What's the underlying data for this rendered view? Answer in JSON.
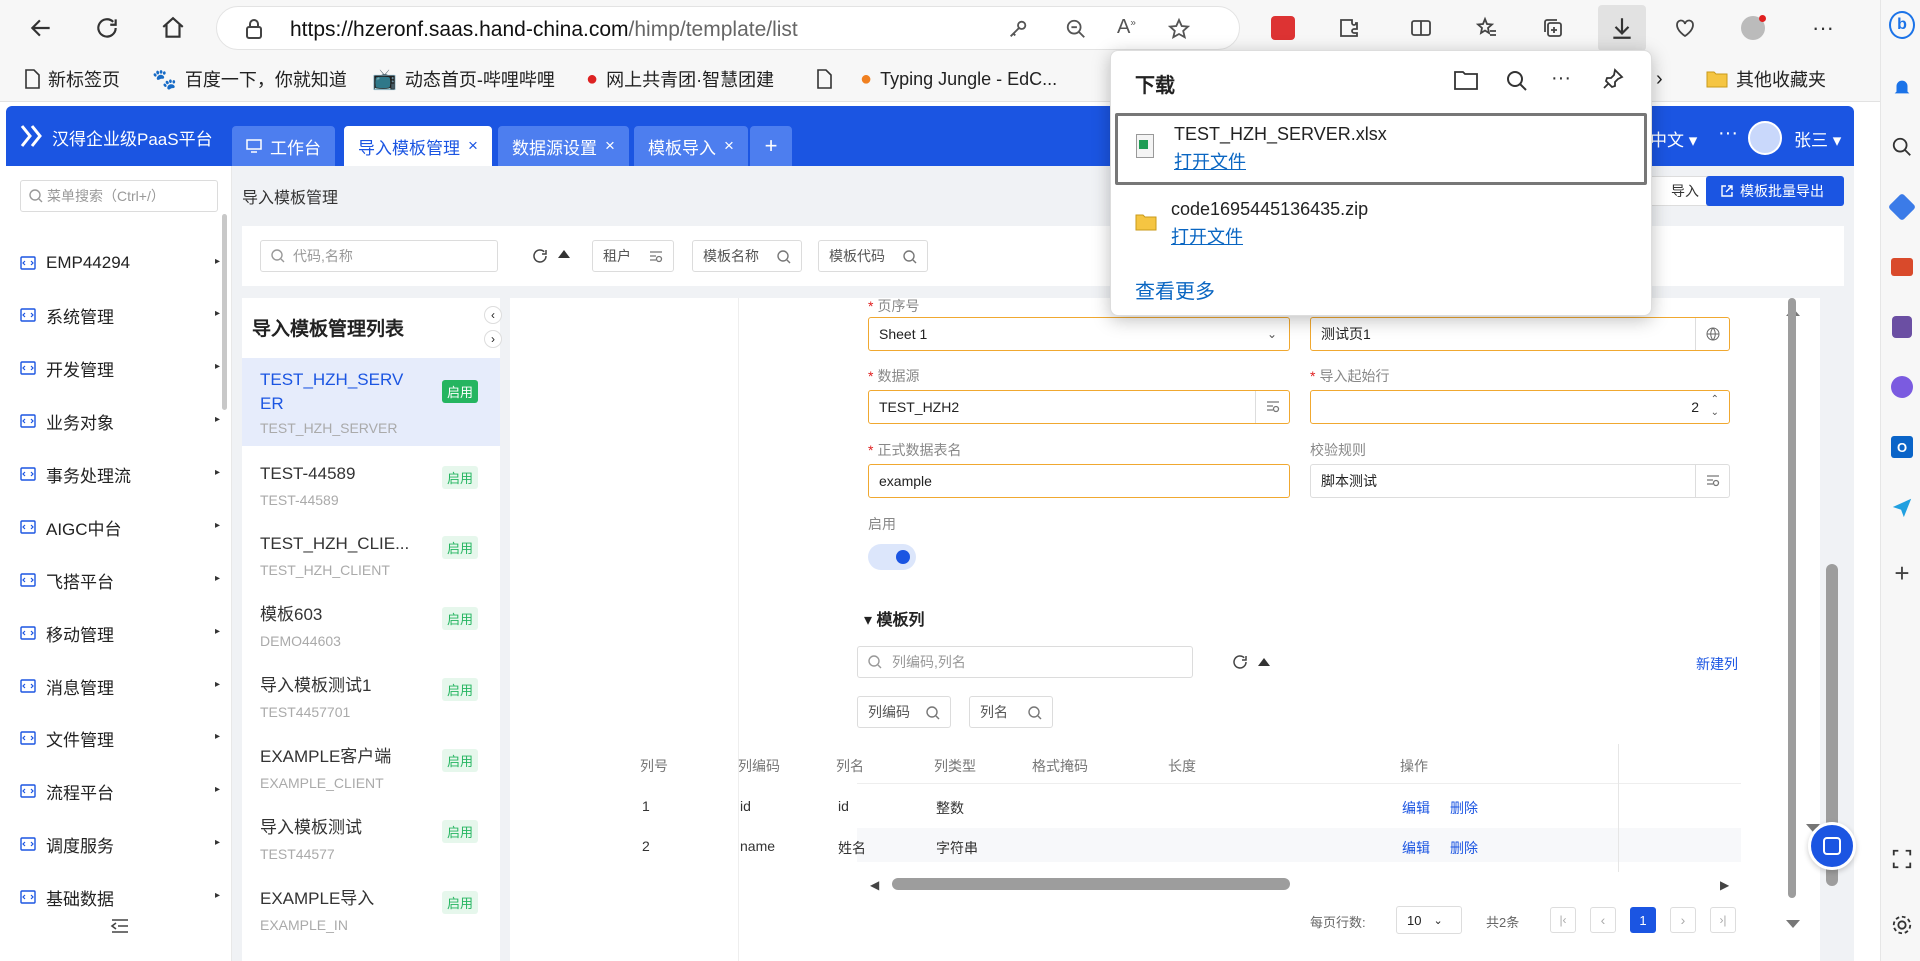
{
  "browser": {
    "url_host": "https://hzeronf.saas.hand-china.com",
    "url_path": "/himp/template/list",
    "bookmarks": [
      "新标签页",
      "百度一下，你就知道",
      "动态首页-哔哩哔哩",
      "网上共青团·智慧团建",
      "",
      "Typing Jungle - EdC..."
    ],
    "other_bookmarks": "其他收藏夹"
  },
  "downloads": {
    "title": "下载",
    "items": [
      {
        "name": "TEST_HZH_SERVER.xlsx",
        "action": "打开文件"
      },
      {
        "name": "code1695445136435.zip",
        "action": "打开文件"
      }
    ],
    "see_more": "查看更多"
  },
  "app": {
    "brand": "汉得企业级PaaS平台",
    "tabs": [
      "工作台",
      "导入模板管理",
      "数据源设置",
      "模板导入"
    ],
    "add_tab": "+",
    "lang": "中文",
    "more": "···",
    "user": "张三"
  },
  "nav": {
    "search_placeholder": "菜单搜索（Ctrl+/）",
    "items": [
      "EMP44294",
      "系统管理",
      "开发管理",
      "业务对象",
      "事务处理流",
      "AIGC中台",
      "飞搭平台",
      "移动管理",
      "消息管理",
      "文件管理",
      "流程平台",
      "调度服务",
      "基础数据"
    ]
  },
  "page": {
    "breadcrumb": "导入模板管理",
    "import_button": "导入",
    "export_button": "模板批量导出",
    "search_placeholder": "代码,名称",
    "filters": [
      "租户",
      "模板名称",
      "模板代码"
    ]
  },
  "list": {
    "title": "导入模板管理列表",
    "items": [
      {
        "name": "TEST_HZH_SERVER",
        "code": "TEST_HZH_SERVER",
        "status": "启用"
      },
      {
        "name": "TEST-44589",
        "code": "TEST-44589",
        "status": "启用"
      },
      {
        "name": "TEST_HZH_CLIE...",
        "code": "TEST_HZH_CLIENT",
        "status": "启用"
      },
      {
        "name": "模板603",
        "code": "DEMO44603",
        "status": "启用"
      },
      {
        "name": "导入模板测试1",
        "code": "TEST4457701",
        "status": "启用"
      },
      {
        "name": "EXAMPLE客户端",
        "code": "EXAMPLE_CLIENT",
        "status": "启用"
      },
      {
        "name": "导入模板测试",
        "code": "TEST44577",
        "status": "启用"
      },
      {
        "name": "EXAMPLE导入",
        "code": "EXAMPLE_IN",
        "status": "启用"
      }
    ]
  },
  "form": {
    "sheet_label": "页序号",
    "sheet_value": "Sheet 1",
    "sheet_name_value": "测试页1",
    "datasource_label": "数据源",
    "datasource_value": "TEST_HZH2",
    "start_row_label": "导入起始行",
    "start_row_value": "2",
    "table_label": "正式数据表名",
    "table_value": "example",
    "rule_label": "校验规则",
    "rule_value": "脚本测试",
    "enabled_label": "启用"
  },
  "columns_section": {
    "title": "模板列",
    "search_placeholder": "列编码,列名",
    "new_button": "新建列",
    "filters": [
      "列编码",
      "列名"
    ],
    "headers": [
      "列号",
      "列编码",
      "列名",
      "列类型",
      "格式掩码",
      "长度",
      "操作"
    ],
    "rows": [
      {
        "no": "1",
        "code": "id",
        "name": "id",
        "type": "整数"
      },
      {
        "no": "2",
        "code": "name",
        "name": "姓名",
        "type": "字符串"
      }
    ],
    "edit": "编辑",
    "delete": "删除"
  },
  "pagination": {
    "per_page_label": "每页行数:",
    "per_page": "10",
    "total": "共2条",
    "current": "1"
  },
  "colors": {
    "primary": "#1b55e2",
    "success": "#25b560",
    "warning": "#f0a830"
  }
}
